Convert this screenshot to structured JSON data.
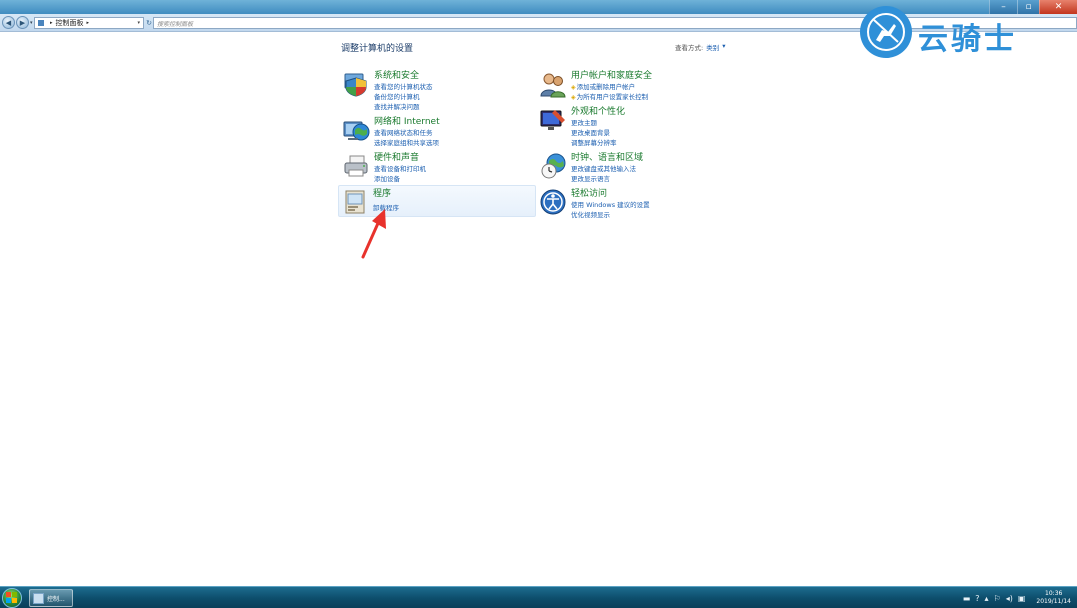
{
  "window": {
    "buttons": {
      "minimize": "–",
      "maximize": "▫",
      "close": "✕"
    }
  },
  "address_bar": {
    "back": "◀",
    "forward": "▶",
    "recent_pages": "▾",
    "breadcrumb": "控制面板",
    "breadcrumb_sep": "▸",
    "address_dropdown": "▾",
    "refresh": "↻",
    "search_placeholder": "搜索控制面板"
  },
  "watermark": {
    "text": "云骑士"
  },
  "content": {
    "title": "调整计算机的设置",
    "view_by_label": "查看方式:",
    "view_by_value": "类别",
    "view_by_arrow": "▾"
  },
  "categories": [
    {
      "title": "系统和安全",
      "links": [
        "查看您的计算机状态",
        "备份您的计算机",
        "查找并解决问题"
      ]
    },
    {
      "title": "网络和 Internet",
      "links": [
        "查看网络状态和任务",
        "选择家庭组和共享选项"
      ]
    },
    {
      "title": "硬件和声音",
      "links": [
        "查看设备和打印机",
        "添加设备"
      ]
    },
    {
      "title": "程序",
      "links": [
        "卸载程序"
      ]
    },
    {
      "title": "用户帐户和家庭安全",
      "links": [
        "添加或删除用户帐户",
        "为所有用户设置家长控制"
      ]
    },
    {
      "title": "外观和个性化",
      "links": [
        "更改主题",
        "更改桌面背景",
        "调整屏幕分辨率"
      ]
    },
    {
      "title": "时钟、语言和区域",
      "links": [
        "更改键盘或其他输入法",
        "更改显示语言"
      ]
    },
    {
      "title": "轻松访问",
      "links": [
        "使用 Windows 建议的设置",
        "优化视频显示"
      ]
    }
  ],
  "taskbar": {
    "active_window_label": "控制...",
    "clock_time": "10:36",
    "clock_date": "2019/11/14"
  },
  "icons": {
    "system": "shield-monitor-icon",
    "network": "globe-network-icon",
    "hardware": "printer-icon",
    "programs": "programs-box-icon",
    "users": "users-icon",
    "appearance": "monitor-paint-icon",
    "clock": "clock-globe-icon",
    "ease": "accessibility-icon"
  },
  "colors": {
    "category_title": "#1a7a2e",
    "link": "#1c5fb0",
    "taskbar": "#0d4d6b",
    "arrow": "#e8322c",
    "watermark": "#2f90d8"
  }
}
